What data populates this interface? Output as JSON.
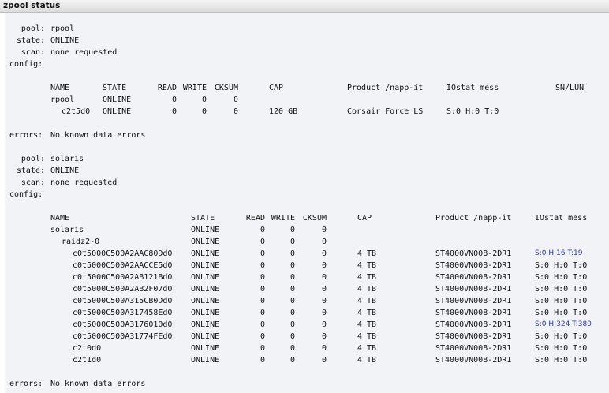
{
  "window": {
    "title": "zpool status"
  },
  "labels": {
    "pool": "pool:",
    "state": "state:",
    "scan": "scan:",
    "config": "config:",
    "errors": "errors:"
  },
  "table_headers": {
    "name": "NAME",
    "state": "STATE",
    "read": "READ",
    "write": "WRITE",
    "cksum": "CKSUM",
    "cap": "CAP",
    "product": "Product /napp-it",
    "iostat": "IOstat mess",
    "sn": "SN/LUN"
  },
  "pool1": {
    "name": "rpool",
    "state": "ONLINE",
    "scan": "none requested",
    "rows": [
      {
        "name": "rpool",
        "state": "ONLINE",
        "read": "0",
        "write": "0",
        "cksum": "0",
        "cap": "",
        "product": "",
        "iostat": ""
      },
      {
        "name": "c2t5d0",
        "state": "ONLINE",
        "read": "0",
        "write": "0",
        "cksum": "0",
        "cap": "120 GB",
        "product": "Corsair Force LS",
        "iostat": "S:0 H:0 T:0"
      }
    ],
    "errors": "No known data errors"
  },
  "pool2": {
    "name": "solaris",
    "state": "ONLINE",
    "scan": "none requested",
    "rows": [
      {
        "name": "solaris",
        "state": "ONLINE",
        "read": "0",
        "write": "0",
        "cksum": "0",
        "cap": "",
        "product": "",
        "iostat": ""
      },
      {
        "name": "raidz2-0",
        "state": "ONLINE",
        "read": "0",
        "write": "0",
        "cksum": "0",
        "cap": "",
        "product": "",
        "iostat": ""
      },
      {
        "name": "c0t5000C500A2AAC80Dd0",
        "state": "ONLINE",
        "read": "0",
        "write": "0",
        "cksum": "0",
        "cap": "4 TB",
        "product": "ST4000VN008-2DR1",
        "iostat": "S:0 H:16 T:19"
      },
      {
        "name": "c0t5000C500A2AACCE5d0",
        "state": "ONLINE",
        "read": "0",
        "write": "0",
        "cksum": "0",
        "cap": "4 TB",
        "product": "ST4000VN008-2DR1",
        "iostat": "S:0 H:0 T:0"
      },
      {
        "name": "c0t5000C500A2AB121Bd0",
        "state": "ONLINE",
        "read": "0",
        "write": "0",
        "cksum": "0",
        "cap": "4 TB",
        "product": "ST4000VN008-2DR1",
        "iostat": "S:0 H:0 T:0"
      },
      {
        "name": "c0t5000C500A2AB2F07d0",
        "state": "ONLINE",
        "read": "0",
        "write": "0",
        "cksum": "0",
        "cap": "4 TB",
        "product": "ST4000VN008-2DR1",
        "iostat": "S:0 H:0 T:0"
      },
      {
        "name": "c0t5000C500A315CB0Dd0",
        "state": "ONLINE",
        "read": "0",
        "write": "0",
        "cksum": "0",
        "cap": "4 TB",
        "product": "ST4000VN008-2DR1",
        "iostat": "S:0 H:0 T:0"
      },
      {
        "name": "c0t5000C500A317458Ed0",
        "state": "ONLINE",
        "read": "0",
        "write": "0",
        "cksum": "0",
        "cap": "4 TB",
        "product": "ST4000VN008-2DR1",
        "iostat": "S:0 H:0 T:0"
      },
      {
        "name": "c0t5000C500A3176010d0",
        "state": "ONLINE",
        "read": "0",
        "write": "0",
        "cksum": "0",
        "cap": "4 TB",
        "product": "ST4000VN008-2DR1",
        "iostat": "S:0 H:324 T:380"
      },
      {
        "name": "c0t5000C500A31774FEd0",
        "state": "ONLINE",
        "read": "0",
        "write": "0",
        "cksum": "0",
        "cap": "4 TB",
        "product": "ST4000VN008-2DR1",
        "iostat": "S:0 H:0 T:0"
      },
      {
        "name": "c2t0d0",
        "state": "ONLINE",
        "read": "0",
        "write": "0",
        "cksum": "0",
        "cap": "4 TB",
        "product": "ST4000VN008-2DR1",
        "iostat": "S:0 H:0 T:0"
      },
      {
        "name": "c2t1d0",
        "state": "ONLINE",
        "read": "0",
        "write": "0",
        "cksum": "0",
        "cap": "4 TB",
        "product": "ST4000VN008-2DR1",
        "iostat": "S:0 H:0 T:0"
      }
    ],
    "errors": "No known data errors"
  },
  "colors": {
    "panel_bg": "#f2f3f6",
    "iostat_highlight": "#2b3aa0"
  }
}
